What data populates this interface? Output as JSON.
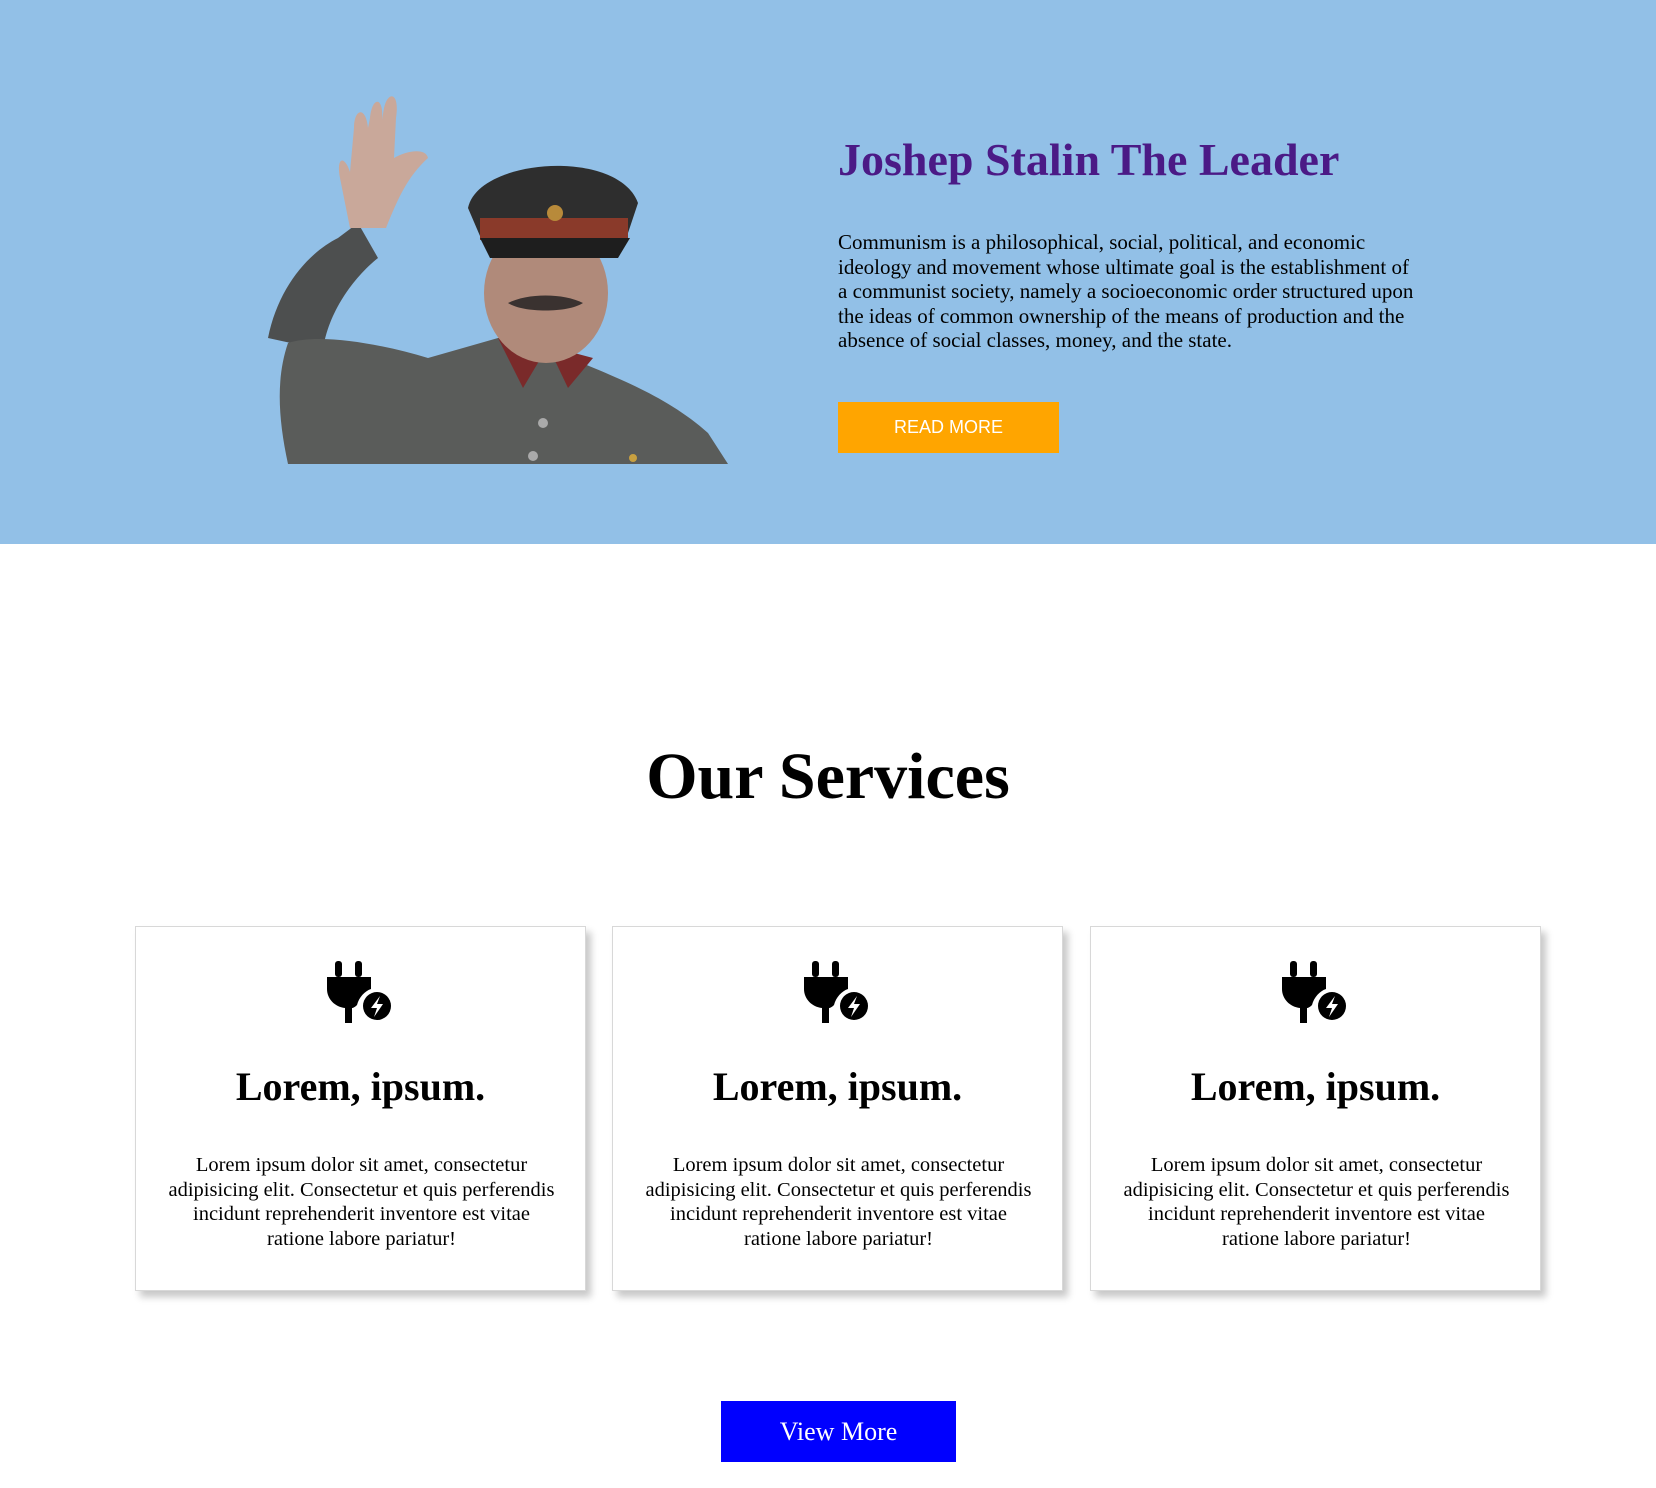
{
  "hero": {
    "title": "Joshep Stalin The Leader",
    "description": "Communism is a philosophical, social, political, and economic ideology and movement whose ultimate goal is the establishment of a communist society, namely a socioeconomic order structured upon the ideas of common ownership of the means of production and the absence of social classes, money, and the state.",
    "button_label": "READ MORE",
    "background_color": "#92c0e7",
    "title_color": "#4b1a86",
    "button_color": "#ffa500"
  },
  "services": {
    "title": "Our Services",
    "cards": [
      {
        "icon": "plug-bolt-icon",
        "title": "Lorem, ipsum.",
        "text": "Lorem ipsum dolor sit amet, consectetur adipisicing elit. Consectetur et quis perferendis incidunt reprehenderit inventore est vitae ratione labore pariatur!"
      },
      {
        "icon": "plug-bolt-icon",
        "title": "Lorem, ipsum.",
        "text": "Lorem ipsum dolor sit amet, consectetur adipisicing elit. Consectetur et quis perferendis incidunt reprehenderit inventore est vitae ratione labore pariatur!"
      },
      {
        "icon": "plug-bolt-icon",
        "title": "Lorem, ipsum.",
        "text": "Lorem ipsum dolor sit amet, consectetur adipisicing elit. Consectetur et quis perferendis incidunt reprehenderit inventore est vitae ratione labore pariatur!"
      }
    ],
    "button_label": "View More",
    "button_color": "#0000ff"
  }
}
